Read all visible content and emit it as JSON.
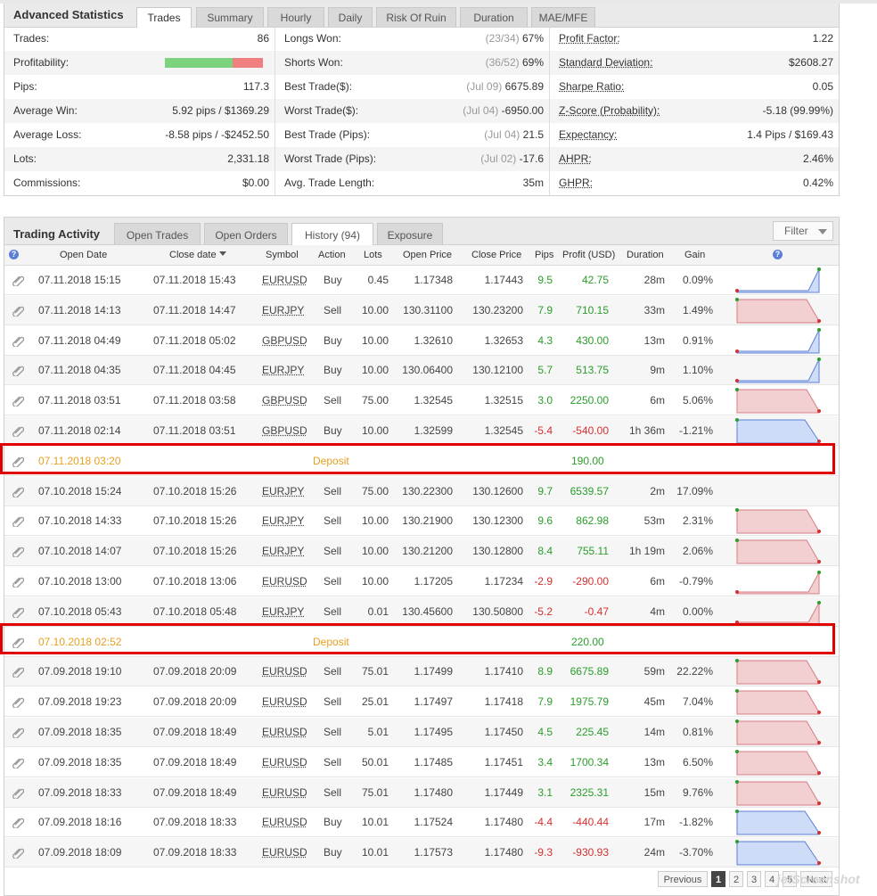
{
  "stats": {
    "title": "Advanced Statistics",
    "tabs": [
      "Trades",
      "Summary",
      "Hourly",
      "Daily",
      "Risk Of Ruin",
      "Duration",
      "MAE/MFE"
    ],
    "active_tab": "Trades",
    "col1": [
      {
        "label": "Trades:",
        "value": "86"
      },
      {
        "label": "Profitability:",
        "value": ""
      },
      {
        "label": "Pips:",
        "value": "117.3"
      },
      {
        "label": "Average Win:",
        "value": "5.92 pips / $1369.29"
      },
      {
        "label": "Average Loss:",
        "value": "-8.58 pips / -$2452.50"
      },
      {
        "label": "Lots:",
        "value": "2,331.18"
      },
      {
        "label": "Commissions:",
        "value": "$0.00"
      }
    ],
    "profitability_win_fraction": 0.69,
    "colors": {
      "win": "#7dd37d",
      "loss": "#f08080"
    },
    "col2": [
      {
        "label": "Longs Won:",
        "date": "(23/34)",
        "value": "67%"
      },
      {
        "label": "Shorts Won:",
        "date": "(36/52)",
        "value": "69%"
      },
      {
        "label": "Best Trade($):",
        "date": "(Jul 09)",
        "value": "6675.89"
      },
      {
        "label": "Worst Trade($):",
        "date": "(Jul 04)",
        "value": "-6950.00"
      },
      {
        "label": "Best Trade (Pips):",
        "date": "(Jul 04)",
        "value": "21.5"
      },
      {
        "label": "Worst Trade (Pips):",
        "date": "(Jul 02)",
        "value": "-17.6"
      },
      {
        "label": "Avg. Trade Length:",
        "date": "",
        "value": "35m"
      }
    ],
    "col3": [
      {
        "label": "Profit Factor:",
        "value": "1.22"
      },
      {
        "label": "Standard Deviation:",
        "value": "$2608.27"
      },
      {
        "label": "Sharpe Ratio:",
        "value": "0.05"
      },
      {
        "label": "Z-Score (Probability):",
        "value": "-5.18 (99.99%)"
      },
      {
        "label": "Expectancy:",
        "value": "1.4 Pips / $169.43"
      },
      {
        "label": "AHPR:",
        "value": "2.46%"
      },
      {
        "label": "GHPR:",
        "value": "0.42%"
      }
    ]
  },
  "activity": {
    "title": "Trading Activity",
    "tabs": [
      "Open Trades",
      "Open Orders",
      "History (94)",
      "Exposure"
    ],
    "active_tab": "History (94)",
    "filter_label": "Filter",
    "columns": [
      "Open Date",
      "Close date",
      "Symbol",
      "Action",
      "Lots",
      "Open Price",
      "Close Price",
      "Pips",
      "Profit (USD)",
      "Duration",
      "Gain"
    ],
    "rows": [
      {
        "open": "07.11.2018 15:15",
        "close": "07.11.2018 15:43",
        "symbol": "EURUSD",
        "action": "Buy",
        "lots": "0.45",
        "open_price": "1.17348",
        "close_price": "1.17443",
        "pips": "9.5",
        "profit": "42.75",
        "duration": "28m",
        "gain": "0.09%",
        "spark": "up"
      },
      {
        "open": "07.11.2018 14:13",
        "close": "07.11.2018 14:47",
        "symbol": "EURJPY",
        "action": "Sell",
        "lots": "10.00",
        "open_price": "130.31100",
        "close_price": "130.23200",
        "pips": "7.9",
        "profit": "710.15",
        "duration": "33m",
        "gain": "1.49%",
        "spark": "sell"
      },
      {
        "open": "07.11.2018 04:49",
        "close": "07.11.2018 05:02",
        "symbol": "GBPUSD",
        "action": "Buy",
        "lots": "10.00",
        "open_price": "1.32610",
        "close_price": "1.32653",
        "pips": "4.3",
        "profit": "430.00",
        "duration": "13m",
        "gain": "0.91%",
        "spark": "up"
      },
      {
        "open": "07.11.2018 04:35",
        "close": "07.11.2018 04:45",
        "symbol": "EURJPY",
        "action": "Buy",
        "lots": "10.00",
        "open_price": "130.06400",
        "close_price": "130.12100",
        "pips": "5.7",
        "profit": "513.75",
        "duration": "9m",
        "gain": "1.10%",
        "spark": "up"
      },
      {
        "open": "07.11.2018 03:51",
        "close": "07.11.2018 03:58",
        "symbol": "GBPUSD",
        "action": "Sell",
        "lots": "75.00",
        "open_price": "1.32545",
        "close_price": "1.32515",
        "pips": "3.0",
        "profit": "2250.00",
        "duration": "6m",
        "gain": "5.06%",
        "spark": "sell"
      },
      {
        "open": "07.11.2018 02:14",
        "close": "07.11.2018 03:51",
        "symbol": "GBPUSD",
        "action": "Buy",
        "lots": "10.00",
        "open_price": "1.32599",
        "close_price": "1.32545",
        "pips": "-5.4",
        "profit": "-540.00",
        "duration": "1h 36m",
        "gain": "-1.21%",
        "spark": "buyloss"
      },
      {
        "deposit": true,
        "open": "07.11.2018 03:20",
        "label": "Deposit",
        "profit": "190.00"
      },
      {
        "open": "07.10.2018 15:24",
        "close": "07.10.2018 15:26",
        "symbol": "EURJPY",
        "action": "Sell",
        "lots": "75.00",
        "open_price": "130.22300",
        "close_price": "130.12600",
        "pips": "9.7",
        "profit": "6539.57",
        "duration": "2m",
        "gain": "17.09%",
        "spark": "none"
      },
      {
        "open": "07.10.2018 14:33",
        "close": "07.10.2018 15:26",
        "symbol": "EURJPY",
        "action": "Sell",
        "lots": "10.00",
        "open_price": "130.21900",
        "close_price": "130.12300",
        "pips": "9.6",
        "profit": "862.98",
        "duration": "53m",
        "gain": "2.31%",
        "spark": "sell"
      },
      {
        "open": "07.10.2018 14:07",
        "close": "07.10.2018 15:26",
        "symbol": "EURJPY",
        "action": "Sell",
        "lots": "10.00",
        "open_price": "130.21200",
        "close_price": "130.12800",
        "pips": "8.4",
        "profit": "755.11",
        "duration": "1h 19m",
        "gain": "2.06%",
        "spark": "sell"
      },
      {
        "open": "07.10.2018 13:00",
        "close": "07.10.2018 13:06",
        "symbol": "EURUSD",
        "action": "Sell",
        "lots": "10.00",
        "open_price": "1.17205",
        "close_price": "1.17234",
        "pips": "-2.9",
        "profit": "-290.00",
        "duration": "6m",
        "gain": "-0.79%",
        "spark": "sellloss"
      },
      {
        "open": "07.10.2018 05:43",
        "close": "07.10.2018 05:48",
        "symbol": "EURJPY",
        "action": "Sell",
        "lots": "0.01",
        "open_price": "130.45600",
        "close_price": "130.50800",
        "pips": "-5.2",
        "profit": "-0.47",
        "duration": "4m",
        "gain": "0.00%",
        "spark": "sellloss"
      },
      {
        "deposit": true,
        "open": "07.10.2018 02:52",
        "label": "Deposit",
        "profit": "220.00"
      },
      {
        "open": "07.09.2018 19:10",
        "close": "07.09.2018 20:09",
        "symbol": "EURUSD",
        "action": "Sell",
        "lots": "75.01",
        "open_price": "1.17499",
        "close_price": "1.17410",
        "pips": "8.9",
        "profit": "6675.89",
        "duration": "59m",
        "gain": "22.22%",
        "spark": "sell"
      },
      {
        "open": "07.09.2018 19:23",
        "close": "07.09.2018 20:09",
        "symbol": "EURUSD",
        "action": "Sell",
        "lots": "25.01",
        "open_price": "1.17497",
        "close_price": "1.17418",
        "pips": "7.9",
        "profit": "1975.79",
        "duration": "45m",
        "gain": "7.04%",
        "spark": "sell"
      },
      {
        "open": "07.09.2018 18:35",
        "close": "07.09.2018 18:49",
        "symbol": "EURUSD",
        "action": "Sell",
        "lots": "5.01",
        "open_price": "1.17495",
        "close_price": "1.17450",
        "pips": "4.5",
        "profit": "225.45",
        "duration": "14m",
        "gain": "0.81%",
        "spark": "sell"
      },
      {
        "open": "07.09.2018 18:35",
        "close": "07.09.2018 18:49",
        "symbol": "EURUSD",
        "action": "Sell",
        "lots": "50.01",
        "open_price": "1.17485",
        "close_price": "1.17451",
        "pips": "3.4",
        "profit": "1700.34",
        "duration": "13m",
        "gain": "6.50%",
        "spark": "sell"
      },
      {
        "open": "07.09.2018 18:33",
        "close": "07.09.2018 18:49",
        "symbol": "EURUSD",
        "action": "Sell",
        "lots": "75.01",
        "open_price": "1.17480",
        "close_price": "1.17449",
        "pips": "3.1",
        "profit": "2325.31",
        "duration": "15m",
        "gain": "9.76%",
        "spark": "sell"
      },
      {
        "open": "07.09.2018 18:16",
        "close": "07.09.2018 18:33",
        "symbol": "EURUSD",
        "action": "Buy",
        "lots": "10.01",
        "open_price": "1.17524",
        "close_price": "1.17480",
        "pips": "-4.4",
        "profit": "-440.44",
        "duration": "17m",
        "gain": "-1.82%",
        "spark": "buyloss"
      },
      {
        "open": "07.09.2018 18:09",
        "close": "07.09.2018 18:33",
        "symbol": "EURUSD",
        "action": "Buy",
        "lots": "10.01",
        "open_price": "1.17573",
        "close_price": "1.17480",
        "pips": "-9.3",
        "profit": "-930.93",
        "duration": "24m",
        "gain": "-3.70%",
        "spark": "buyloss"
      }
    ],
    "pagination": {
      "previous": "Previous",
      "pages": [
        "1",
        "2",
        "3",
        "4",
        "5"
      ],
      "current": "1",
      "next": "Next"
    }
  },
  "watermark": "jetScreenshot",
  "icons": {
    "row_icon": "paperclip-icon",
    "help_icon": "question-icon"
  }
}
